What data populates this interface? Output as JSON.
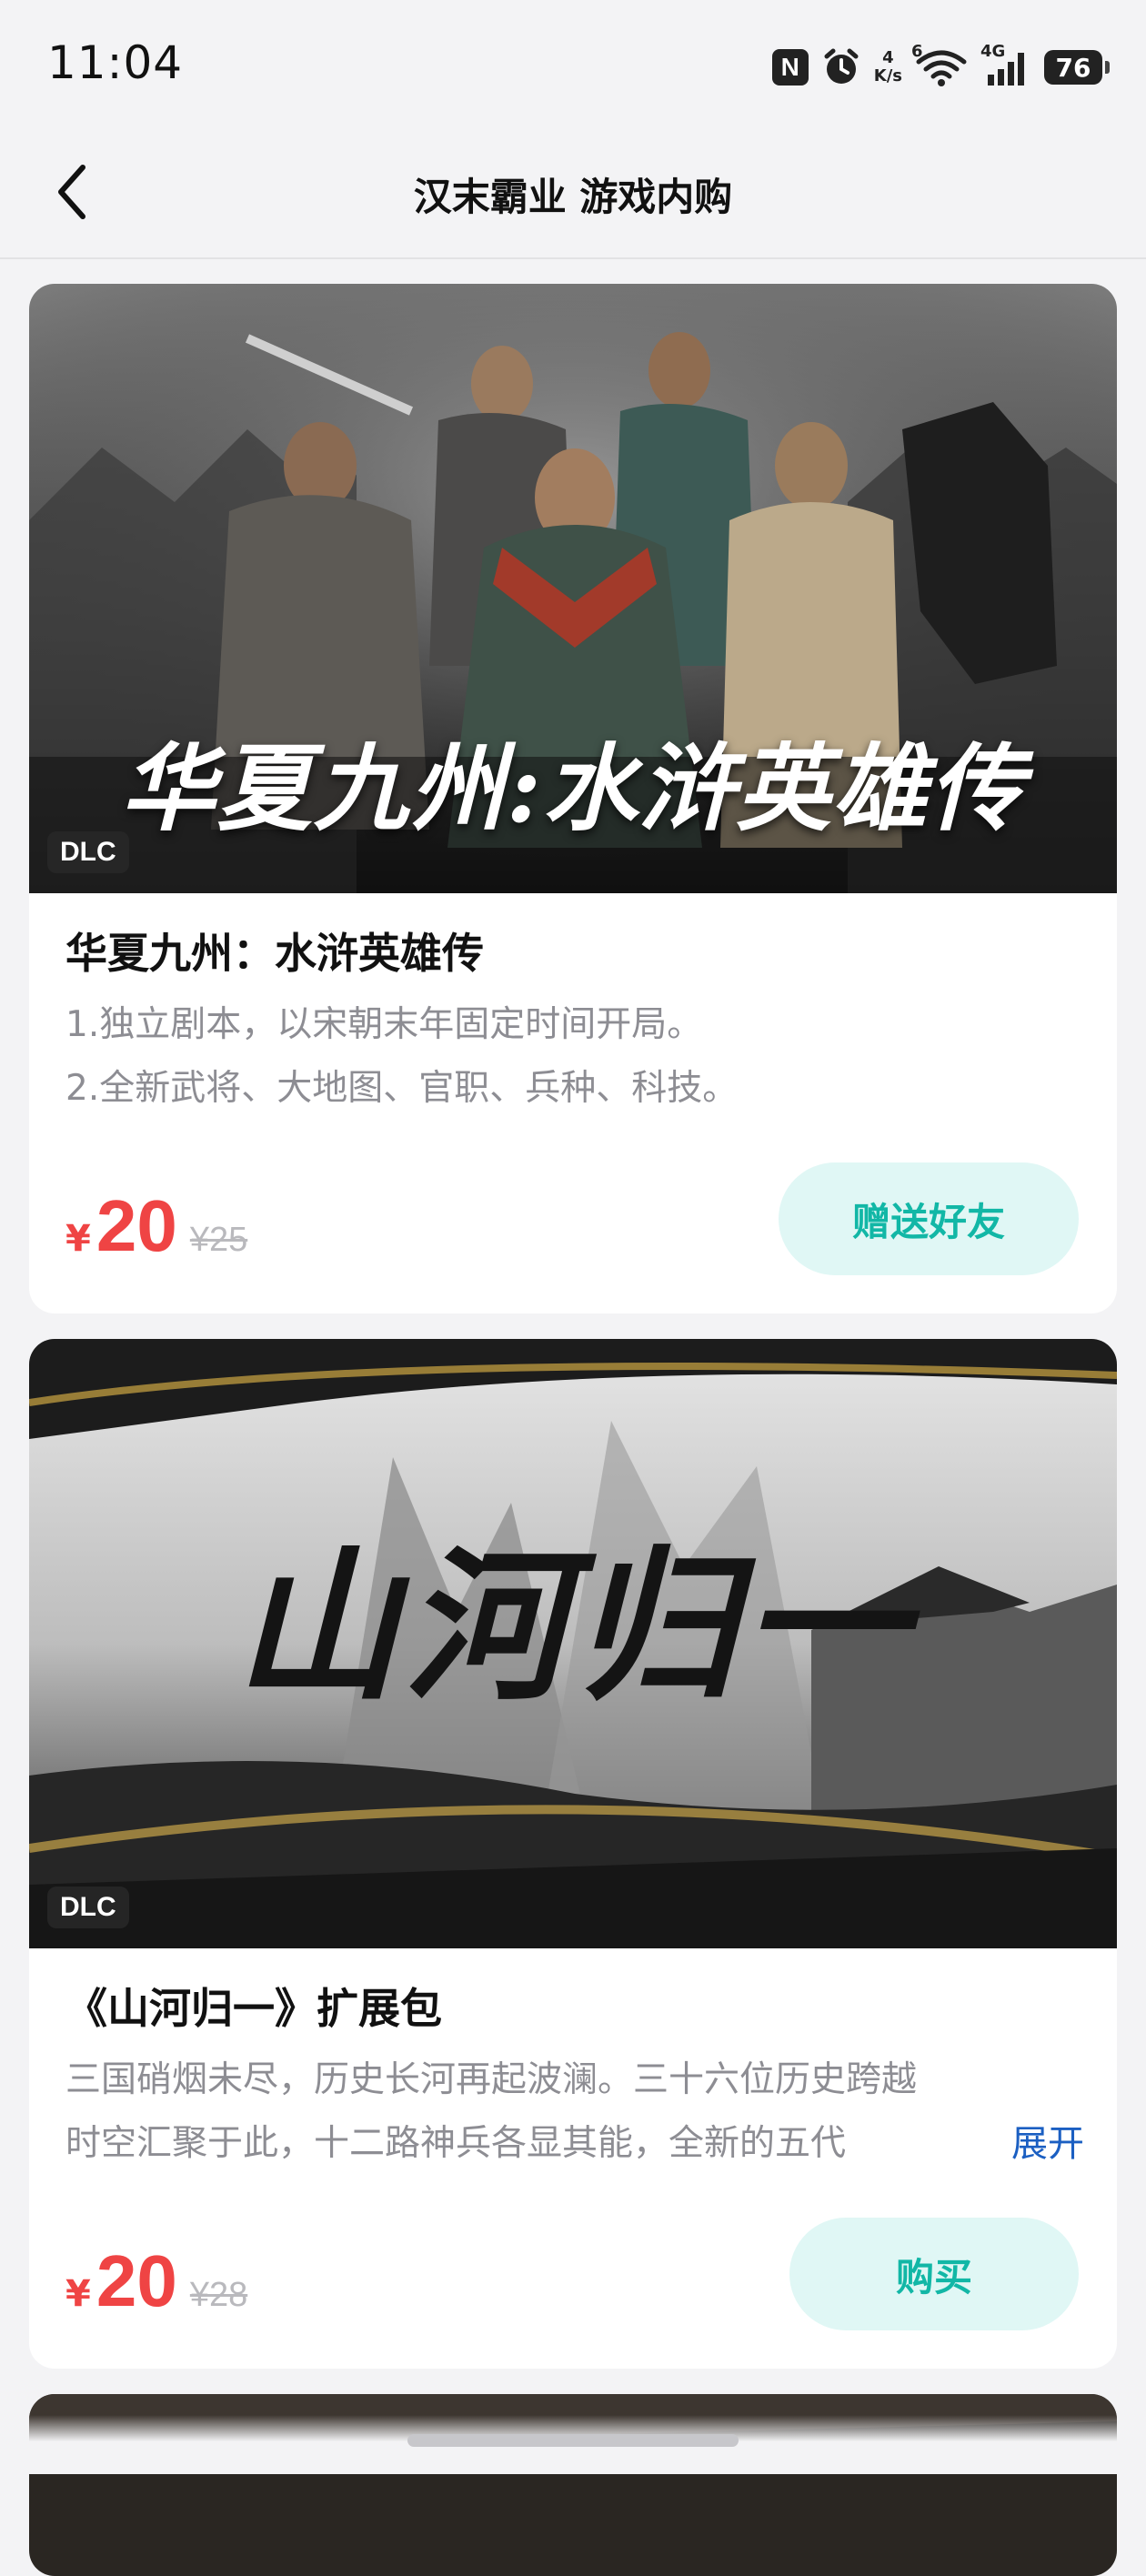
{
  "status_bar": {
    "time": "11:04",
    "nfc": "N",
    "net_speed_value": "4",
    "net_speed_unit": "K/s",
    "wifi_label": "6",
    "cell_label": "4G",
    "battery": "76"
  },
  "header": {
    "title": "汉末霸业 游戏内购"
  },
  "items": [
    {
      "badge": "DLC",
      "banner_text": "华夏九州:水浒英雄传",
      "title": "华夏九州：水浒英雄传",
      "desc_lines": [
        "1.独立剧本，以宋朝末年固定时间开局。",
        "2.全新武将、大地图、官职、兵种、科技。"
      ],
      "currency": "¥",
      "price": "20",
      "original_price": "¥25",
      "action": "赠送好友"
    },
    {
      "badge": "DLC",
      "banner_text": "山河归一",
      "title": "《山河归一》扩展包",
      "desc_lines": [
        "三国硝烟未尽，历史长河再起波澜。三十六位历史跨越",
        "时空汇聚于此，十二路神兵各显其能，全新的五代"
      ],
      "expand": "展开",
      "currency": "¥",
      "price": "20",
      "original_price": "¥28",
      "action": "购买"
    }
  ],
  "colors": {
    "price": "#ef4444",
    "action_bg": "#e0f7f5",
    "action_text": "#12b7a6",
    "link": "#1b5fc2"
  }
}
